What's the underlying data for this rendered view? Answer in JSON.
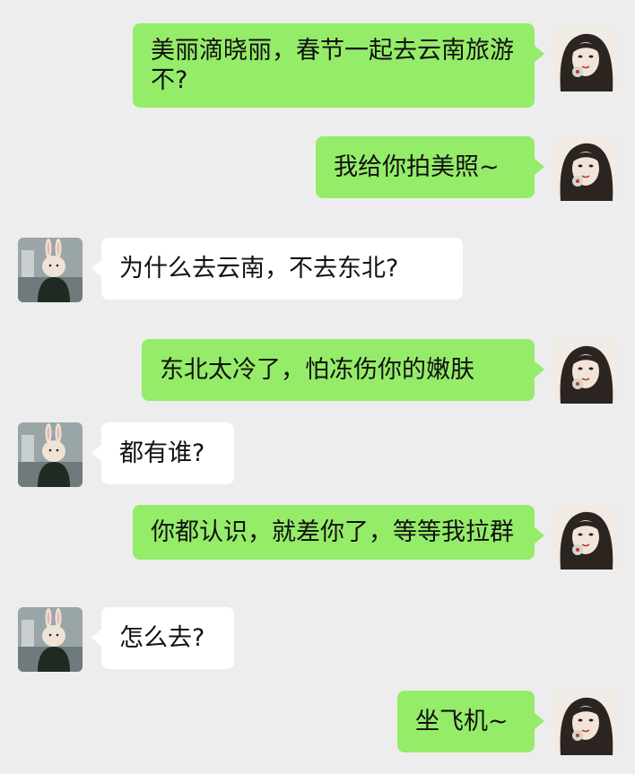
{
  "messages": [
    {
      "sender": "me",
      "text": "美丽滴晓丽，春节一起去云南旅游不?"
    },
    {
      "sender": "me",
      "text": "我给你拍美照~"
    },
    {
      "sender": "them",
      "text": "为什么去云南，不去东北?"
    },
    {
      "sender": "me",
      "text": "东北太冷了，怕冻伤你的嫩肤"
    },
    {
      "sender": "them",
      "text": "都有谁?"
    },
    {
      "sender": "me",
      "text": "你都认识，就差你了，等等我拉群"
    },
    {
      "sender": "them",
      "text": "怎么去?"
    },
    {
      "sender": "me",
      "text": "坐飞机~"
    }
  ],
  "colors": {
    "background": "#ededed",
    "my_bubble": "#95ec69",
    "their_bubble": "#ffffff"
  },
  "icons": {
    "my_avatar": "woman-portrait-avatar",
    "their_avatar": "rabbit-head-avatar"
  }
}
